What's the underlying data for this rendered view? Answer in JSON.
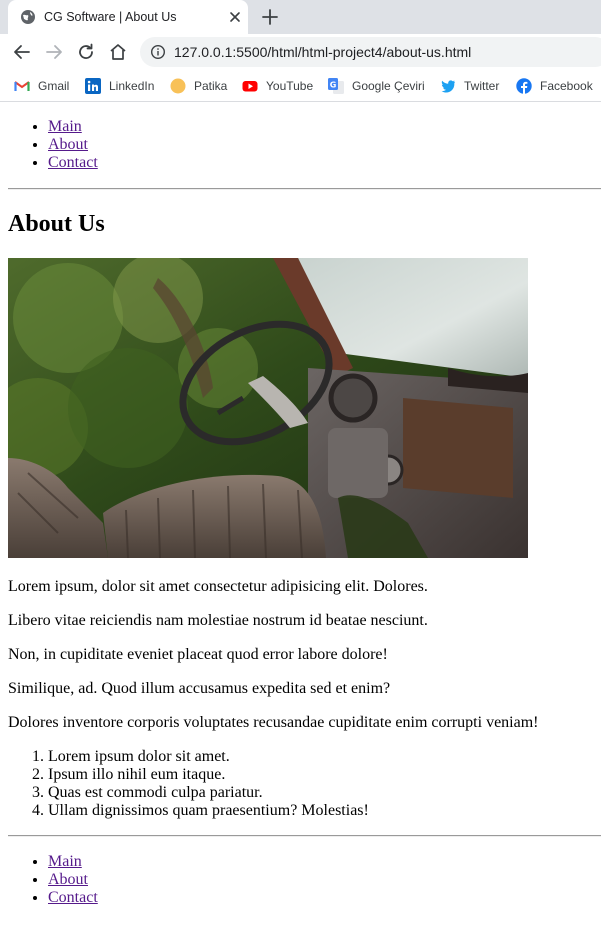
{
  "browser": {
    "tab_title": "CG Software | About Us",
    "url": "127.0.0.1:5500/html/html-project4/about-us.html",
    "bookmarks": [
      {
        "label": "Gmail",
        "icon": "gmail-icon"
      },
      {
        "label": "LinkedIn",
        "icon": "linkedin-icon"
      },
      {
        "label": "Patika",
        "icon": "patika-icon"
      },
      {
        "label": "YouTube",
        "icon": "youtube-icon"
      },
      {
        "label": "Google Çeviri",
        "icon": "google-translate-icon"
      },
      {
        "label": "Twitter",
        "icon": "twitter-icon"
      },
      {
        "label": "Facebook",
        "icon": "facebook-icon"
      }
    ]
  },
  "colors": {
    "visited_link": "#551a8b",
    "tabstrip_bg": "#dee1e6",
    "omnibox_bg": "#f1f3f4"
  },
  "top_nav": [
    "Main",
    "About",
    "Contact"
  ],
  "page": {
    "heading": "About Us",
    "image_alt": "car-interior-photo",
    "paragraphs": [
      "Lorem ipsum, dolor sit amet consectetur adipisicing elit. Dolores.",
      "Libero vitae reiciendis nam molestiae nostrum id beatae nesciunt.",
      "Non, in cupiditate eveniet placeat quod error labore dolore!",
      "Similique, ad. Quod illum accusamus expedita sed et enim?",
      "Dolores inventore corporis voluptates recusandae cupiditate enim corrupti veniam!"
    ],
    "ordered_list": [
      "Lorem ipsum dolor sit amet.",
      "Ipsum illo nihil eum itaque.",
      "Quas est commodi culpa pariatur.",
      "Ullam dignissimos quam praesentium? Molestias!"
    ]
  },
  "bottom_nav": [
    "Main",
    "About",
    "Contact"
  ]
}
